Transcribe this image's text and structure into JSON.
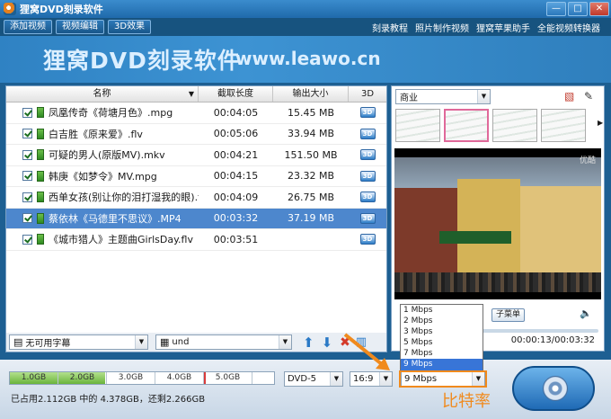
{
  "window": {
    "title": "狸窝DVD刻录软件",
    "min": "—",
    "max": "□",
    "close": "✕"
  },
  "menubar": {
    "tabs": [
      "添加视频",
      "视频编辑",
      "3D效果"
    ],
    "links": [
      "刻录教程",
      "照片制作视频",
      "狸窝苹果助手",
      "全能视频转换器"
    ]
  },
  "banner": {
    "brand": "狸窝DVD刻录软件",
    "url": "www.leawo.cn"
  },
  "table": {
    "headers": {
      "name": "名称",
      "duration": "截取长度",
      "size": "输出大小",
      "three_d": "3D"
    },
    "rows": [
      {
        "name": "凤凰传奇《荷塘月色》.mpg",
        "duration": "00:04:05",
        "size": "15.45 MB",
        "selected": false
      },
      {
        "name": "白吉胜《原来爱》.flv",
        "duration": "00:05:06",
        "size": "33.94 MB",
        "selected": false
      },
      {
        "name": "可疑的男人(原版MV).mkv",
        "duration": "00:04:21",
        "size": "151.50 MB",
        "selected": false
      },
      {
        "name": "韩庚《如梦令》MV.mpg",
        "duration": "00:04:15",
        "size": "23.32 MB",
        "selected": false
      },
      {
        "name": "西单女孩(别让你的泪打湿我的眼).flv",
        "duration": "00:04:09",
        "size": "26.75 MB",
        "selected": false
      },
      {
        "name": "蔡依林《马德里不思议》.MP4",
        "duration": "00:03:32",
        "size": "37.19 MB",
        "selected": true
      },
      {
        "name": "《城市猎人》主题曲GirlsDay.flv",
        "duration": "00:03:51",
        "size": "",
        "selected": false
      }
    ]
  },
  "subtitle_combo": "无可用字幕",
  "audio_combo": "und",
  "template_combo": "商业",
  "preview": {
    "submenu_button": "子菜单",
    "time": "00:00:13/00:03:32",
    "logo": "优酷"
  },
  "capacity": {
    "ticks": [
      "1.0GB",
      "2.0GB",
      "3.0GB",
      "4.0GB",
      "5.0GB"
    ],
    "used_fraction": 0.36,
    "limit_fraction": 0.735,
    "text": "已占用2.112GB 中的 4.378GB，还剩2.266GB"
  },
  "disc_combo": "DVD-5",
  "aspect_combo": "16:9",
  "bitrate_combo": "9 Mbps",
  "bitrate_options": [
    "1 Mbps",
    "2 Mbps",
    "3 Mbps",
    "5 Mbps",
    "7 Mbps",
    "9 Mbps"
  ],
  "bitrate_highlight": "9 Mbps",
  "annotation": "比特率"
}
